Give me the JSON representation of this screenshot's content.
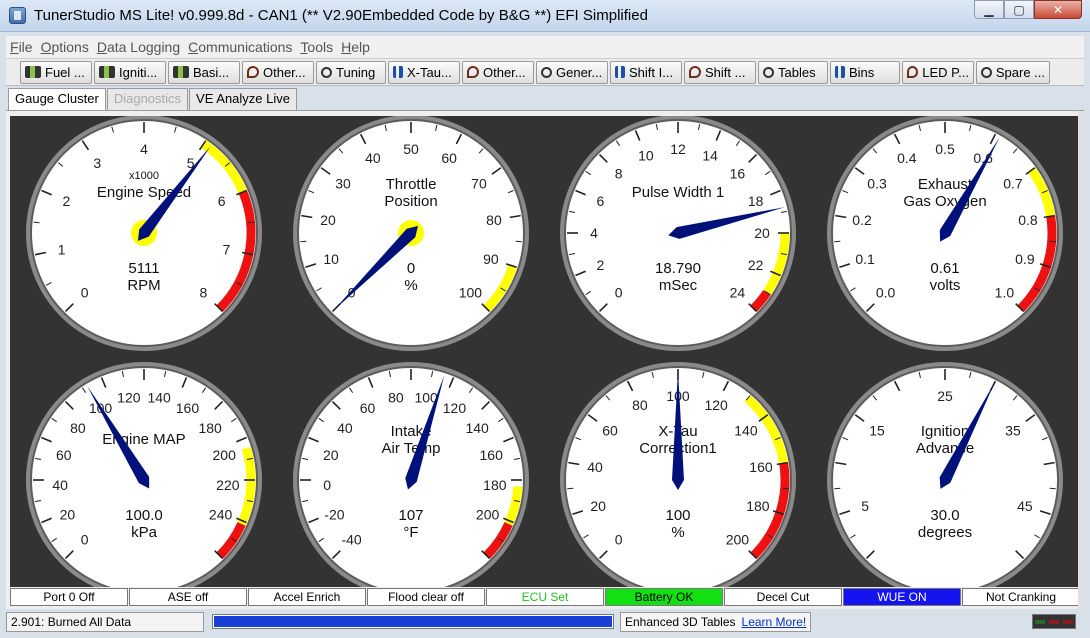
{
  "window": {
    "title": "TunerStudio MS Lite! v0.999.8d - CAN1 (** V2.90Embedded Code by B&G **) EFI Simplified"
  },
  "menu": [
    "File",
    "Options",
    "Data Logging",
    "Communications",
    "Tools",
    "Help"
  ],
  "toolbar": [
    {
      "label": "Fuel ...",
      "icon": "connector-icon"
    },
    {
      "label": "Igniti...",
      "icon": "spark-icon"
    },
    {
      "label": "Basi...",
      "icon": "connector-icon"
    },
    {
      "label": "Other...",
      "icon": "hammer-icon"
    },
    {
      "label": "Tuning",
      "icon": "wrench-icon"
    },
    {
      "label": "X-Tau...",
      "icon": "bars-icon"
    },
    {
      "label": "Other...",
      "icon": "hammer-icon"
    },
    {
      "label": "Gener...",
      "icon": "wrench-icon"
    },
    {
      "label": "Shift I...",
      "icon": "bars-icon"
    },
    {
      "label": "Shift ...",
      "icon": "hammer-icon"
    },
    {
      "label": "Tables",
      "icon": "wrench-icon"
    },
    {
      "label": "Bins",
      "icon": "bars-icon"
    },
    {
      "label": "LED P...",
      "icon": "hammer-icon"
    },
    {
      "label": "Spare ...",
      "icon": "wrench-icon"
    }
  ],
  "tabs": [
    {
      "label": "Gauge Cluster",
      "state": "active"
    },
    {
      "label": "Diagnostics",
      "state": "disabled"
    },
    {
      "label": "VE Analyze Live",
      "state": "normal"
    }
  ],
  "colors": {
    "needle": "#00127a",
    "warning": "#ffff00",
    "danger": "#ee1111",
    "panel": "#333333",
    "face": "#ffffff"
  },
  "gauges": [
    {
      "title": [
        "Engine Speed"
      ],
      "multiplier": "x1000",
      "value": "5111",
      "units": "RPM",
      "min": 0,
      "max": 8,
      "reading": 5.111,
      "labels": [
        "0",
        "1",
        "2",
        "3",
        "4",
        "5",
        "6",
        "7",
        "8"
      ],
      "yellow": [
        5,
        6
      ],
      "red": [
        6,
        8
      ],
      "hub": true
    },
    {
      "title": [
        "Throttle",
        "Position"
      ],
      "multiplier": "",
      "value": "0",
      "units": "%",
      "min": 0,
      "max": 100,
      "reading": 0,
      "labels": [
        "0",
        "10",
        "20",
        "30",
        "40",
        "50",
        "60",
        "70",
        "80",
        "90",
        "100"
      ],
      "yellow": [
        90,
        100
      ],
      "red": null,
      "hub": true
    },
    {
      "title": [
        "Pulse Width 1"
      ],
      "multiplier": "",
      "value": "18.790",
      "units": "mSec",
      "min": 0,
      "max": 24,
      "reading": 18.79,
      "labels": [
        "0",
        "2",
        "4",
        "6",
        "8",
        "10",
        "12",
        "14",
        "16",
        "18",
        "20",
        "22",
        "24"
      ],
      "yellow": [
        20,
        23
      ],
      "red": [
        23,
        24
      ],
      "hub": false
    },
    {
      "title": [
        "Exhaust",
        "Gas Oxygen"
      ],
      "multiplier": "",
      "value": "0.61",
      "units": "volts",
      "min": 0,
      "max": 1.0,
      "reading": 0.61,
      "labels": [
        "0.0",
        "0.1",
        "0.2",
        "0.3",
        "0.4",
        "0.5",
        "0.6",
        "0.7",
        "0.8",
        "0.9",
        "1.0"
      ],
      "yellow": [
        0.7,
        0.8
      ],
      "red": [
        0.8,
        1.0
      ],
      "hub": false
    },
    {
      "title": [
        "Engine MAP"
      ],
      "multiplier": "",
      "value": "100.0",
      "units": "kPa",
      "min": 0,
      "max": 260,
      "reading": 100,
      "labels": [
        "0",
        "20",
        "40",
        "60",
        "80",
        "100",
        "120",
        "140",
        "160",
        "180",
        "200",
        "220",
        "240"
      ],
      "yellow": [
        200,
        240
      ],
      "red": [
        240,
        260
      ],
      "hub": false
    },
    {
      "title": [
        "Intake",
        "Air Temp"
      ],
      "multiplier": "",
      "value": "107",
      "units": "°F",
      "min": -40,
      "max": 220,
      "reading": 107,
      "labels": [
        "-40",
        "-20",
        "0",
        "20",
        "40",
        "60",
        "80",
        "100",
        "120",
        "140",
        "160",
        "180",
        "200"
      ],
      "yellow": [
        180,
        200
      ],
      "red": [
        200,
        220
      ],
      "hub": false
    },
    {
      "title": [
        "X-Tau",
        "Correction1"
      ],
      "multiplier": "",
      "value": "100",
      "units": "%",
      "min": 0,
      "max": 200,
      "reading": 100,
      "labels": [
        "0",
        "20",
        "40",
        "60",
        "80",
        "100",
        "120",
        "140",
        "160",
        "180",
        "200"
      ],
      "yellow": [
        130,
        160
      ],
      "red": [
        160,
        200
      ],
      "hub": false
    },
    {
      "title": [
        "Ignition",
        "Advance"
      ],
      "multiplier": "",
      "value": "30.0",
      "units": "degrees",
      "min": 0,
      "max": 50,
      "reading": 30,
      "labels": [
        "5",
        "15",
        "25",
        "35",
        "45"
      ],
      "label_values": [
        5,
        15,
        25,
        35,
        45
      ],
      "yellow": null,
      "red": null,
      "hub": false
    }
  ],
  "indicators": [
    {
      "label": "Port 0 Off",
      "style": "plain"
    },
    {
      "label": "ASE off",
      "style": "plain"
    },
    {
      "label": "Accel Enrich",
      "style": "plain"
    },
    {
      "label": "Flood clear off",
      "style": "plain"
    },
    {
      "label": "ECU Set",
      "style": "green-text"
    },
    {
      "label": "Battery OK",
      "style": "green"
    },
    {
      "label": "Decel Cut",
      "style": "plain"
    },
    {
      "label": "WUE ON",
      "style": "blue"
    },
    {
      "label": "Not Cranking",
      "style": "plain"
    }
  ],
  "status": {
    "message": "2.901: Burned All Data",
    "progress": 1.0,
    "promo": "Enhanced 3D Tables",
    "promo_link": "Learn More!"
  }
}
